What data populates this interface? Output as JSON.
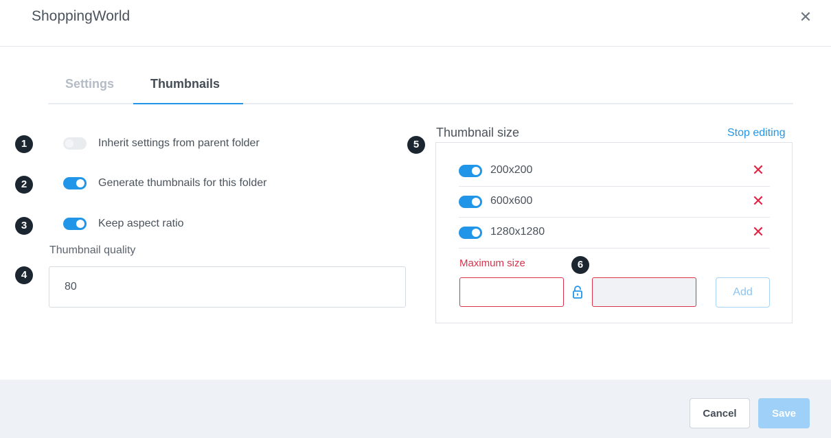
{
  "header": {
    "title": "ShoppingWorld",
    "close_symbol": "✕"
  },
  "tabs": [
    {
      "label": "Settings",
      "active": false
    },
    {
      "label": "Thumbnails",
      "active": true
    }
  ],
  "badges": [
    "1",
    "2",
    "3",
    "4",
    "5",
    "6"
  ],
  "options": {
    "inherit": {
      "label": "Inherit settings from parent folder",
      "enabled": false
    },
    "generate": {
      "label": "Generate thumbnails for this folder",
      "enabled": true
    },
    "aspect": {
      "label": "Keep aspect ratio",
      "enabled": true
    }
  },
  "quality": {
    "label": "Thumbnail quality",
    "value": "80"
  },
  "sizes": {
    "title": "Thumbnail size",
    "stop_editing": "Stop editing",
    "items": [
      {
        "label": "200x200",
        "enabled": true
      },
      {
        "label": "600x600",
        "enabled": true
      },
      {
        "label": "1280x1280",
        "enabled": true
      }
    ],
    "delete_symbol": "✕",
    "max_size_label": "Maximum size",
    "add_label": "Add"
  },
  "footer": {
    "cancel_label": "Cancel",
    "save_label": "Save"
  },
  "colors": {
    "accent": "#2196e8",
    "danger": "#e02444",
    "badge": "#1b2630"
  }
}
